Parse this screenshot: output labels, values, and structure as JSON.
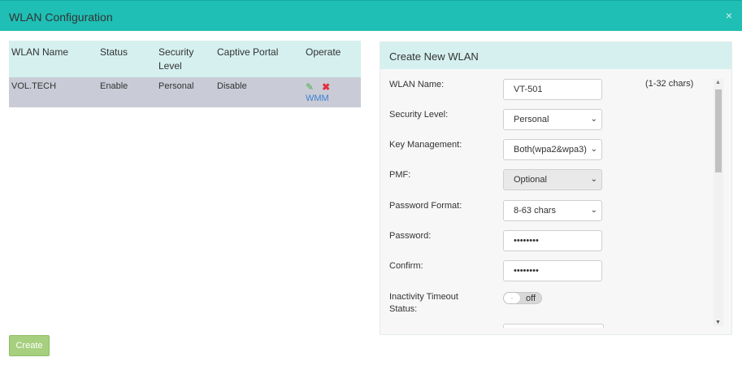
{
  "dialog": {
    "title": "WLAN Configuration",
    "close_icon": "×"
  },
  "table": {
    "headers": [
      "WLAN Name",
      "Status",
      "Security Level",
      "Captive Portal",
      "Operate"
    ],
    "rows": [
      {
        "name": "VOL.TECH",
        "status": "Enable",
        "security": "Personal",
        "portal": "Disable",
        "edit_icon": "✎",
        "delete_icon": "✖",
        "wmm": "WMM"
      }
    ]
  },
  "create_button": "Create",
  "panel": {
    "title": "Create New WLAN",
    "fields": {
      "wlan_name": {
        "label": "WLAN Name:",
        "value": "VT-501",
        "hint": "(1-32 chars)"
      },
      "security_level": {
        "label": "Security Level:",
        "value": "Personal"
      },
      "key_management": {
        "label": "Key Management:",
        "value": "Both(wpa2&wpa3)"
      },
      "pmf": {
        "label": "PMF:",
        "value": "Optional"
      },
      "password_format": {
        "label": "Password Format:",
        "value": "8-63 chars"
      },
      "password": {
        "label": "Password:",
        "value": "••••••••"
      },
      "confirm": {
        "label": "Confirm:",
        "value": "••••••••"
      },
      "inactivity": {
        "label_line1": "Inactivity Timeout",
        "label_line2": "Status:",
        "state": "off",
        "enabled": false
      }
    }
  },
  "colors": {
    "title_bar": "#1fbfb5",
    "header_bg": "#d5f0ef",
    "row_bg": "#c9ccd6",
    "create_button": "#a6cf7e"
  }
}
